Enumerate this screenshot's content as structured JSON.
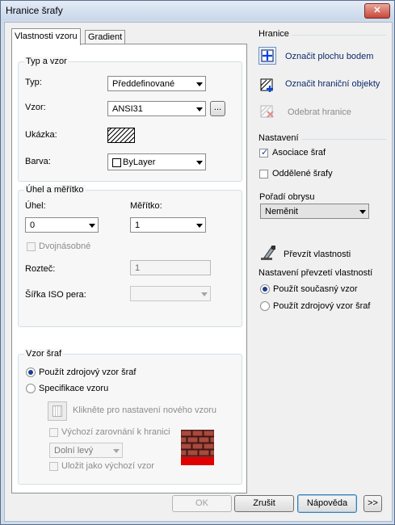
{
  "window": {
    "title": "Hranice šrafy",
    "close_label": "✕"
  },
  "tabs": [
    {
      "label": "Vlastnosti vzoru"
    },
    {
      "label": "Gradient"
    }
  ],
  "type_pattern": {
    "group_label": "Typ a vzor",
    "type_label": "Typ:",
    "type_value": "Předdefinované",
    "pattern_label": "Vzor:",
    "pattern_value": "ANSI31",
    "pattern_browse": "...",
    "sample_label": "Ukázka:",
    "color_label": "Barva:",
    "color_value": "ByLayer"
  },
  "angle_scale": {
    "group_label": "Úhel a měřítko",
    "angle_label": "Úhel:",
    "angle_value": "0",
    "scale_label": "Měřítko:",
    "scale_value": "1",
    "double_label": "Dvojnásobné",
    "spacing_label": "Rozteč:",
    "spacing_value": "1",
    "iso_label": "Šířka ISO pera:",
    "iso_value": ""
  },
  "pattern_origin": {
    "group_label": "Vzor šraf",
    "use_source_label": "Použít zdrojový vzor šraf",
    "specify_label": "Specifikace vzoru",
    "click_set_label": "Klikněte pro nastavení nového vzoru",
    "default_align_label": "Výchozí zarovnání k hranici",
    "position_value": "Dolní levý",
    "store_default_label": "Uložit jako výchozí vzor"
  },
  "boundaries": {
    "group_label": "Hranice",
    "pick_area_label": "Označit plochu bodem",
    "select_objects_label": "Označit hraniční objekty",
    "remove_label": "Odebrat hranice"
  },
  "options": {
    "group_label": "Nastavení",
    "associative_label": "Asociace šraf",
    "associative_checked": true,
    "separate_label": "Oddělené šrafy",
    "separate_checked": false,
    "draw_order_label": "Pořadí obrysu",
    "draw_order_value": "Neměnit"
  },
  "inherit": {
    "button_label": "Převzít vlastnosti",
    "group_label": "Nastavení převzetí vlastností",
    "use_current_label": "Použít současný vzor",
    "use_source_label": "Použít zdrojový vzor šraf"
  },
  "footer": {
    "ok": "OK",
    "cancel": "Zrušit",
    "help": "Nápověda",
    "more": ">>"
  }
}
